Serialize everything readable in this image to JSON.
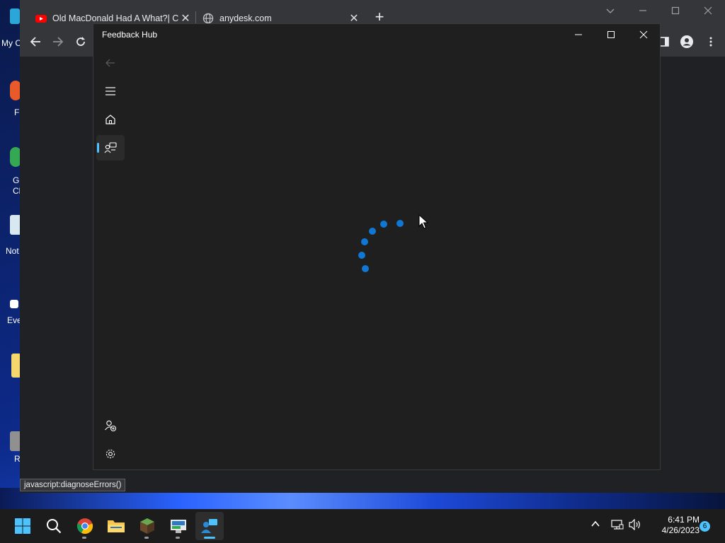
{
  "desktop": {
    "icons": [
      {
        "label": "My C",
        "color": "#2aa7d8"
      },
      {
        "label": "F",
        "color": "#e85a2a"
      },
      {
        "label": "G\nCh",
        "color": "#34a853"
      },
      {
        "label": "Not",
        "color": "#d8e8f0"
      },
      {
        "label": "Eve",
        "color": "#f0c000"
      },
      {
        "label": "",
        "color": "#f5d76e"
      },
      {
        "label": "R",
        "color": "#909090"
      }
    ]
  },
  "browser": {
    "tabs": [
      {
        "title": "Old MacDonald Had A What?| Co",
        "favicon": "youtube-icon",
        "close": "✕"
      },
      {
        "title": "anydesk.com",
        "favicon": "globe-icon",
        "close": "✕"
      }
    ],
    "new_tab": "+",
    "status_text": "javascript:diagnoseErrors()"
  },
  "feedback_hub": {
    "title": "Feedback Hub",
    "nav": [
      {
        "name": "back",
        "active": false
      },
      {
        "name": "menu",
        "active": false
      },
      {
        "name": "home",
        "active": false
      },
      {
        "name": "feedback",
        "active": true
      },
      {
        "name": "add-account",
        "active": false
      },
      {
        "name": "settings",
        "active": false
      }
    ],
    "loading": true
  },
  "taskbar": {
    "apps": [
      "start",
      "search",
      "chrome",
      "file-explorer",
      "minecraft",
      "remote-app",
      "feedback-hub"
    ],
    "active_app": "feedback-hub",
    "time": "6:41 PM",
    "date": "4/26/2023",
    "notification_count": "6"
  },
  "colors": {
    "accent": "#4cc2ff",
    "spinner": "#0f78d4",
    "window_bg": "#1f1f1f",
    "browser_bg": "#35363a"
  }
}
